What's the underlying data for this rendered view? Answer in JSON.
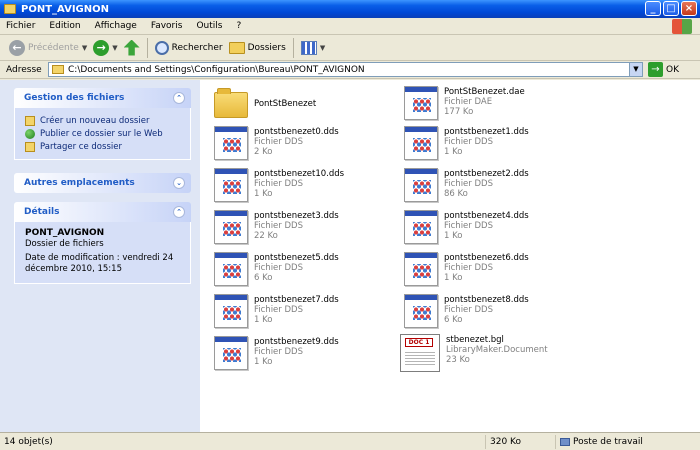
{
  "window": {
    "title": "PONT_AVIGNON"
  },
  "menu": [
    "Fichier",
    "Edition",
    "Affichage",
    "Favoris",
    "Outils",
    "?"
  ],
  "toolbar": {
    "back_label": "Précédente",
    "search_label": "Rechercher",
    "folders_label": "Dossiers"
  },
  "address": {
    "label": "Adresse",
    "value": "C:\\Documents and Settings\\Configuration\\Bureau\\PONT_AVIGNON",
    "go_label": "OK"
  },
  "tasks_panel": {
    "title": "Gestion des fichiers",
    "items": [
      {
        "label": "Créer un nouveau dossier",
        "icon": "new-folder-icon"
      },
      {
        "label": "Publier ce dossier sur le Web",
        "icon": "globe-icon"
      },
      {
        "label": "Partager ce dossier",
        "icon": "share-folder-icon"
      }
    ]
  },
  "places_panel": {
    "title": "Autres emplacements"
  },
  "details_panel": {
    "title": "Détails",
    "name": "PONT_AVIGNON",
    "type": "Dossier de fichiers",
    "modified": "Date de modification : vendredi 24 décembre 2010, 15:15"
  },
  "files": [
    {
      "name": "PontStBenezet",
      "type": "",
      "size": "",
      "icon": "folder-icon"
    },
    {
      "name": "PontStBenezet.dae",
      "type": "Fichier DAE",
      "size": "177 Ko",
      "icon": "document-icon"
    },
    {
      "name": "pontstbenezet0.dds",
      "type": "Fichier DDS",
      "size": "2 Ko",
      "icon": "document-icon"
    },
    {
      "name": "pontstbenezet1.dds",
      "type": "Fichier DDS",
      "size": "1 Ko",
      "icon": "document-icon"
    },
    {
      "name": "pontstbenezet10.dds",
      "type": "Fichier DDS",
      "size": "1 Ko",
      "icon": "document-icon"
    },
    {
      "name": "pontstbenezet2.dds",
      "type": "Fichier DDS",
      "size": "86 Ko",
      "icon": "document-icon"
    },
    {
      "name": "pontstbenezet3.dds",
      "type": "Fichier DDS",
      "size": "22 Ko",
      "icon": "document-icon"
    },
    {
      "name": "pontstbenezet4.dds",
      "type": "Fichier DDS",
      "size": "1 Ko",
      "icon": "document-icon"
    },
    {
      "name": "pontstbenezet5.dds",
      "type": "Fichier DDS",
      "size": "6 Ko",
      "icon": "document-icon"
    },
    {
      "name": "pontstbenezet6.dds",
      "type": "Fichier DDS",
      "size": "1 Ko",
      "icon": "document-icon"
    },
    {
      "name": "pontstbenezet7.dds",
      "type": "Fichier DDS",
      "size": "1 Ko",
      "icon": "document-icon"
    },
    {
      "name": "pontstbenezet8.dds",
      "type": "Fichier DDS",
      "size": "6 Ko",
      "icon": "document-icon"
    },
    {
      "name": "pontstbenezet9.dds",
      "type": "Fichier DDS",
      "size": "1 Ko",
      "icon": "document-icon"
    },
    {
      "name": "stbenezet.bgl",
      "type": "LibraryMaker.Document",
      "size": "23 Ko",
      "icon": "bgl-document-icon",
      "badge": "DOC 1"
    }
  ],
  "status": {
    "count": "14 objet(s)",
    "size": "320 Ko",
    "location": "Poste de travail"
  }
}
